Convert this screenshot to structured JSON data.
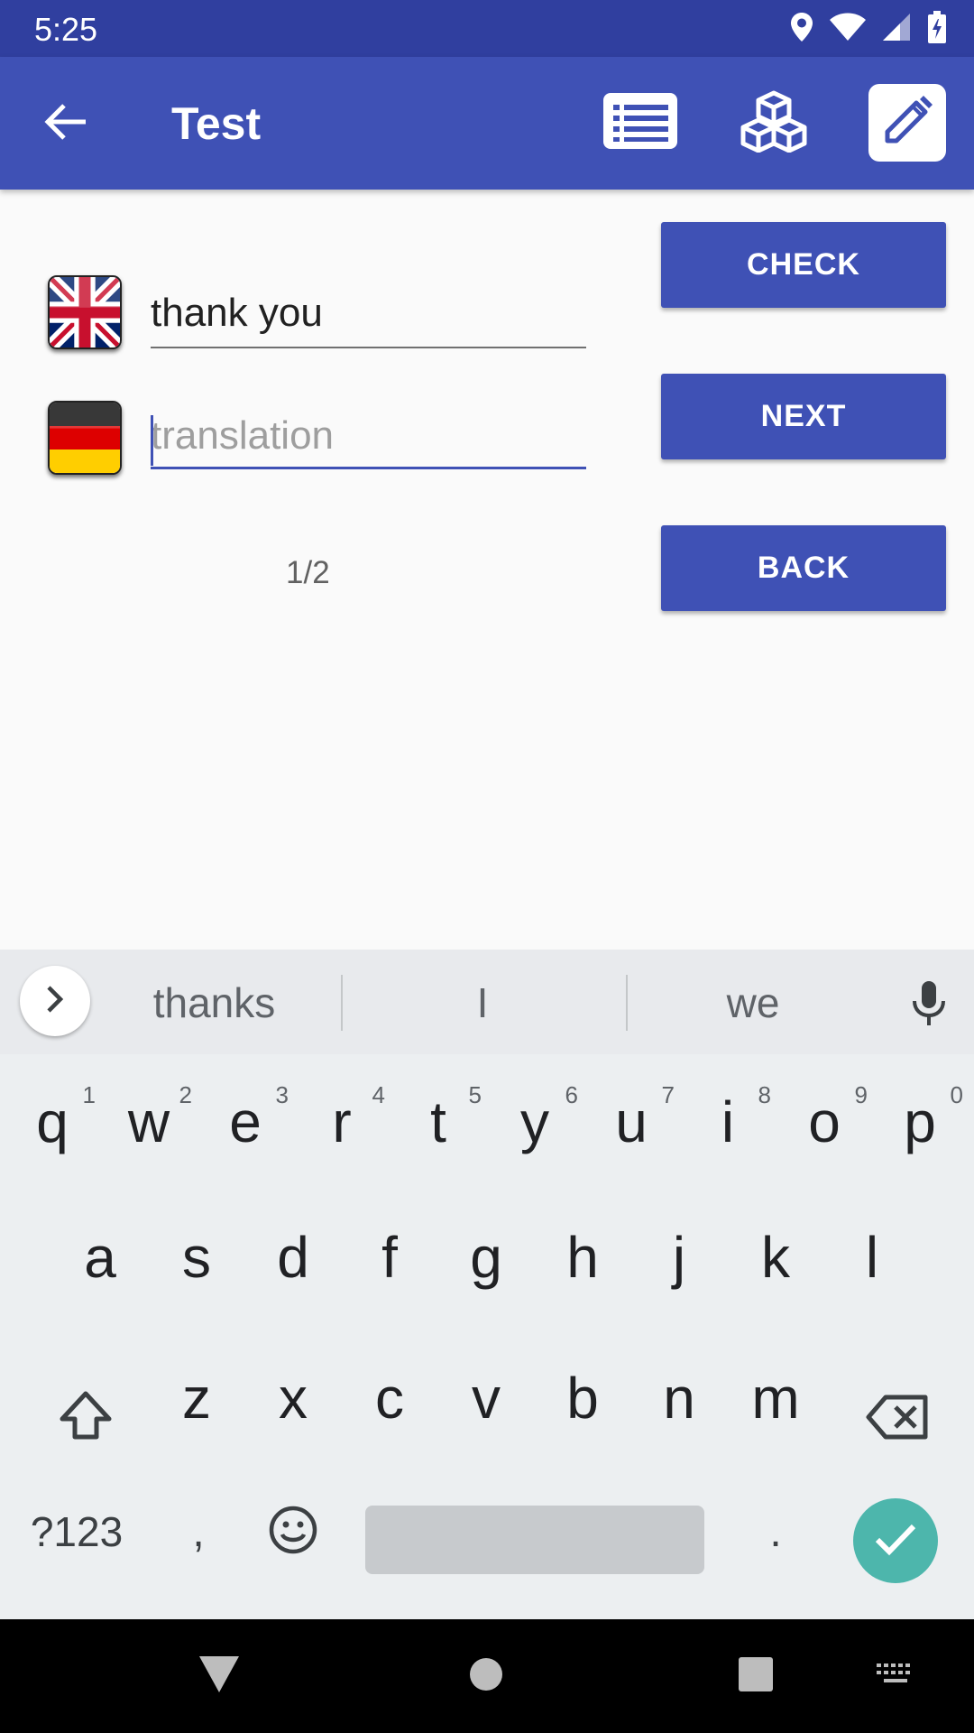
{
  "status_bar": {
    "time": "5:25",
    "icons": [
      "location-icon",
      "wifi-icon",
      "signal-icon",
      "battery-charging-icon"
    ]
  },
  "app_bar": {
    "title": "Test",
    "back_icon": "arrow-back-icon",
    "actions": [
      "list-icon",
      "cubes-icon",
      "edit-icon"
    ],
    "color": "#3f51b5",
    "status_color": "#303f9f"
  },
  "quiz": {
    "source_language_flag": "uk-flag-icon",
    "source_word": "thank you",
    "target_language_flag": "germany-flag-icon",
    "target_value": "",
    "target_placeholder": "translation",
    "counter": "1/2",
    "check_label": "CHECK",
    "next_label": "NEXT",
    "back_label": "BACK"
  },
  "keyboard": {
    "suggestions": [
      "thanks",
      "I",
      "we"
    ],
    "row1": [
      {
        "key": "q",
        "hint": "1"
      },
      {
        "key": "w",
        "hint": "2"
      },
      {
        "key": "e",
        "hint": "3"
      },
      {
        "key": "r",
        "hint": "4"
      },
      {
        "key": "t",
        "hint": "5"
      },
      {
        "key": "y",
        "hint": "6"
      },
      {
        "key": "u",
        "hint": "7"
      },
      {
        "key": "i",
        "hint": "8"
      },
      {
        "key": "o",
        "hint": "9"
      },
      {
        "key": "p",
        "hint": "0"
      }
    ],
    "row2": [
      "a",
      "s",
      "d",
      "f",
      "g",
      "h",
      "j",
      "k",
      "l"
    ],
    "row3": [
      "z",
      "x",
      "c",
      "v",
      "b",
      "n",
      "m"
    ],
    "symbols_label": "?123",
    "comma_label": ",",
    "period_label": ".",
    "accent_color": "#4db6ac"
  },
  "nav_bar": {
    "items": [
      "back-triangle-icon",
      "home-circle-icon",
      "recents-square-icon",
      "keyboard-icon"
    ]
  }
}
